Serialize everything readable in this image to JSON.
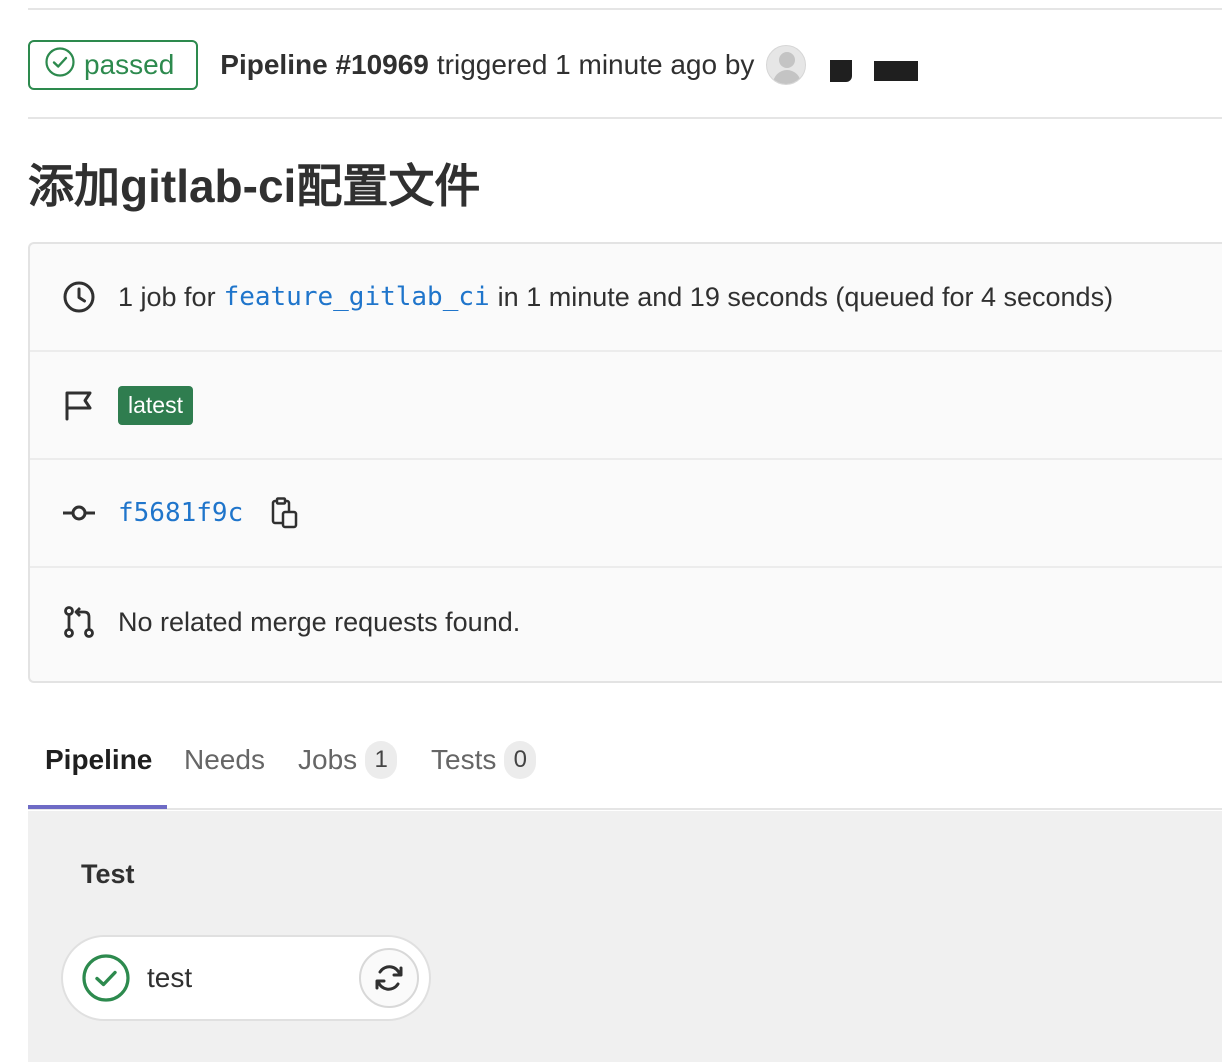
{
  "header": {
    "status_label": "passed",
    "pipeline_label": "Pipeline #10969",
    "triggered_text": "triggered 1 minute ago by"
  },
  "title": "添加gitlab-ci配置文件",
  "info": {
    "jobs": {
      "prefix": "1 job for",
      "branch": "feature_gitlab_ci",
      "suffix": "in 1 minute and 19 seconds (queued for 4 seconds)"
    },
    "badge": "latest",
    "commit_sha": "f5681f9c",
    "merge_requests": "No related merge requests found."
  },
  "tabs": [
    {
      "label": "Pipeline"
    },
    {
      "label": "Needs"
    },
    {
      "label": "Jobs",
      "count": "1"
    },
    {
      "label": "Tests",
      "count": "0"
    }
  ],
  "stage": {
    "title": "Test",
    "jobs": [
      {
        "name": "test",
        "status": "passed"
      }
    ]
  },
  "colors": {
    "success": "#2d8a4e",
    "link": "#1f75cb",
    "tab_active_underline": "#6e6bc5"
  },
  "icons": {
    "status": "check-circle-icon",
    "duration": "clock-icon",
    "badge": "flag-icon",
    "commit": "commit-icon",
    "copy": "clipboard-icon",
    "merge_request": "merge-request-icon",
    "retry": "retry-icon"
  }
}
